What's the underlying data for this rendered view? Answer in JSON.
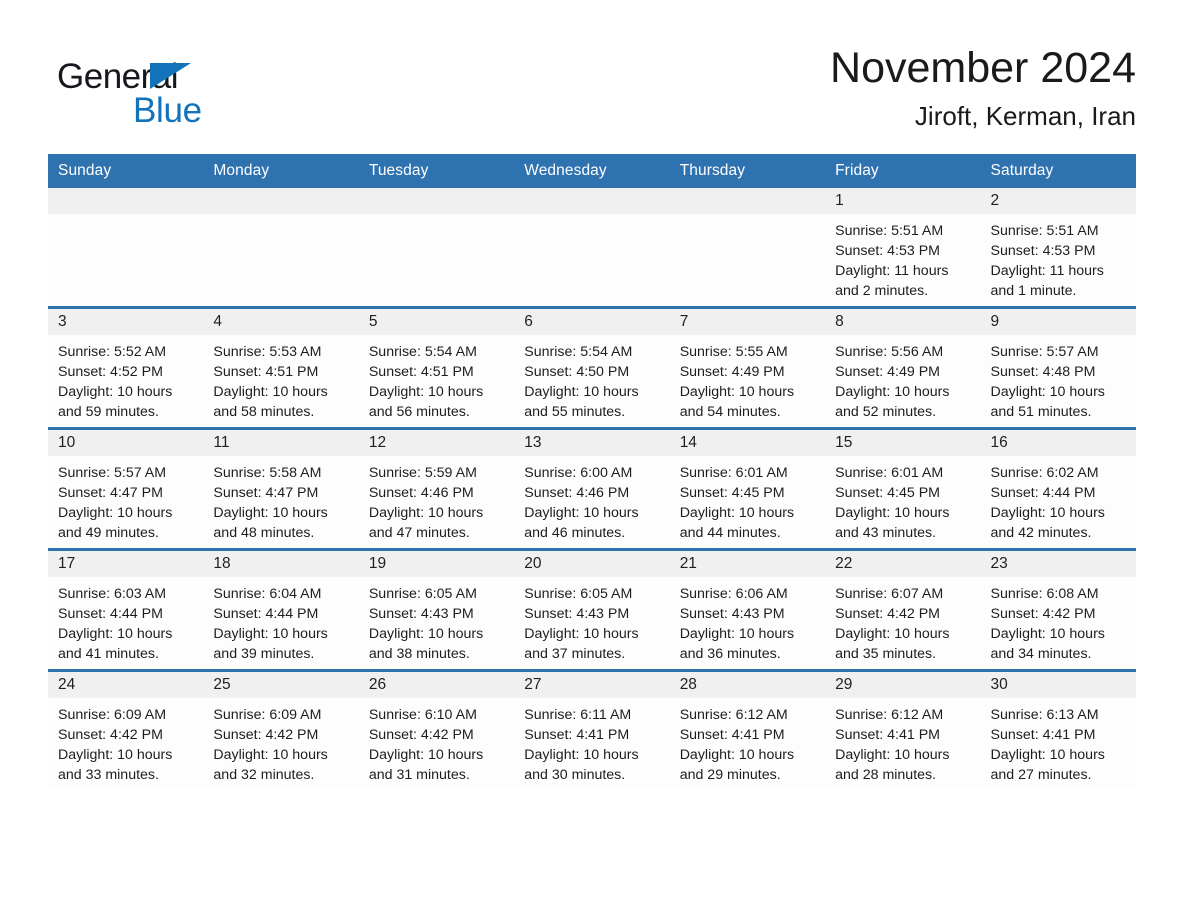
{
  "brand": {
    "name_top": "General",
    "name_bottom": "Blue",
    "accent_color": "#1273bb"
  },
  "header": {
    "title": "November 2024",
    "location": "Jiroft, Kerman, Iran",
    "header_bg_color": "#2e72b0"
  },
  "weekdays": [
    "Sunday",
    "Monday",
    "Tuesday",
    "Wednesday",
    "Thursday",
    "Friday",
    "Saturday"
  ],
  "labels": {
    "sunrise_prefix": "Sunrise:",
    "sunset_prefix": "Sunset:",
    "daylight_prefix": "Daylight:"
  },
  "weeks": [
    [
      {
        "day": "",
        "empty": true
      },
      {
        "day": "",
        "empty": true
      },
      {
        "day": "",
        "empty": true
      },
      {
        "day": "",
        "empty": true
      },
      {
        "day": "",
        "empty": true
      },
      {
        "day": "1",
        "sunrise": "Sunrise: 5:51 AM",
        "sunset": "Sunset: 4:53 PM",
        "daylight": "Daylight: 11 hours and 2 minutes."
      },
      {
        "day": "2",
        "sunrise": "Sunrise: 5:51 AM",
        "sunset": "Sunset: 4:53 PM",
        "daylight": "Daylight: 11 hours and 1 minute."
      }
    ],
    [
      {
        "day": "3",
        "sunrise": "Sunrise: 5:52 AM",
        "sunset": "Sunset: 4:52 PM",
        "daylight": "Daylight: 10 hours and 59 minutes."
      },
      {
        "day": "4",
        "sunrise": "Sunrise: 5:53 AM",
        "sunset": "Sunset: 4:51 PM",
        "daylight": "Daylight: 10 hours and 58 minutes."
      },
      {
        "day": "5",
        "sunrise": "Sunrise: 5:54 AM",
        "sunset": "Sunset: 4:51 PM",
        "daylight": "Daylight: 10 hours and 56 minutes."
      },
      {
        "day": "6",
        "sunrise": "Sunrise: 5:54 AM",
        "sunset": "Sunset: 4:50 PM",
        "daylight": "Daylight: 10 hours and 55 minutes."
      },
      {
        "day": "7",
        "sunrise": "Sunrise: 5:55 AM",
        "sunset": "Sunset: 4:49 PM",
        "daylight": "Daylight: 10 hours and 54 minutes."
      },
      {
        "day": "8",
        "sunrise": "Sunrise: 5:56 AM",
        "sunset": "Sunset: 4:49 PM",
        "daylight": "Daylight: 10 hours and 52 minutes."
      },
      {
        "day": "9",
        "sunrise": "Sunrise: 5:57 AM",
        "sunset": "Sunset: 4:48 PM",
        "daylight": "Daylight: 10 hours and 51 minutes."
      }
    ],
    [
      {
        "day": "10",
        "sunrise": "Sunrise: 5:57 AM",
        "sunset": "Sunset: 4:47 PM",
        "daylight": "Daylight: 10 hours and 49 minutes."
      },
      {
        "day": "11",
        "sunrise": "Sunrise: 5:58 AM",
        "sunset": "Sunset: 4:47 PM",
        "daylight": "Daylight: 10 hours and 48 minutes."
      },
      {
        "day": "12",
        "sunrise": "Sunrise: 5:59 AM",
        "sunset": "Sunset: 4:46 PM",
        "daylight": "Daylight: 10 hours and 47 minutes."
      },
      {
        "day": "13",
        "sunrise": "Sunrise: 6:00 AM",
        "sunset": "Sunset: 4:46 PM",
        "daylight": "Daylight: 10 hours and 46 minutes."
      },
      {
        "day": "14",
        "sunrise": "Sunrise: 6:01 AM",
        "sunset": "Sunset: 4:45 PM",
        "daylight": "Daylight: 10 hours and 44 minutes."
      },
      {
        "day": "15",
        "sunrise": "Sunrise: 6:01 AM",
        "sunset": "Sunset: 4:45 PM",
        "daylight": "Daylight: 10 hours and 43 minutes."
      },
      {
        "day": "16",
        "sunrise": "Sunrise: 6:02 AM",
        "sunset": "Sunset: 4:44 PM",
        "daylight": "Daylight: 10 hours and 42 minutes."
      }
    ],
    [
      {
        "day": "17",
        "sunrise": "Sunrise: 6:03 AM",
        "sunset": "Sunset: 4:44 PM",
        "daylight": "Daylight: 10 hours and 41 minutes."
      },
      {
        "day": "18",
        "sunrise": "Sunrise: 6:04 AM",
        "sunset": "Sunset: 4:44 PM",
        "daylight": "Daylight: 10 hours and 39 minutes."
      },
      {
        "day": "19",
        "sunrise": "Sunrise: 6:05 AM",
        "sunset": "Sunset: 4:43 PM",
        "daylight": "Daylight: 10 hours and 38 minutes."
      },
      {
        "day": "20",
        "sunrise": "Sunrise: 6:05 AM",
        "sunset": "Sunset: 4:43 PM",
        "daylight": "Daylight: 10 hours and 37 minutes."
      },
      {
        "day": "21",
        "sunrise": "Sunrise: 6:06 AM",
        "sunset": "Sunset: 4:43 PM",
        "daylight": "Daylight: 10 hours and 36 minutes."
      },
      {
        "day": "22",
        "sunrise": "Sunrise: 6:07 AM",
        "sunset": "Sunset: 4:42 PM",
        "daylight": "Daylight: 10 hours and 35 minutes."
      },
      {
        "day": "23",
        "sunrise": "Sunrise: 6:08 AM",
        "sunset": "Sunset: 4:42 PM",
        "daylight": "Daylight: 10 hours and 34 minutes."
      }
    ],
    [
      {
        "day": "24",
        "sunrise": "Sunrise: 6:09 AM",
        "sunset": "Sunset: 4:42 PM",
        "daylight": "Daylight: 10 hours and 33 minutes."
      },
      {
        "day": "25",
        "sunrise": "Sunrise: 6:09 AM",
        "sunset": "Sunset: 4:42 PM",
        "daylight": "Daylight: 10 hours and 32 minutes."
      },
      {
        "day": "26",
        "sunrise": "Sunrise: 6:10 AM",
        "sunset": "Sunset: 4:42 PM",
        "daylight": "Daylight: 10 hours and 31 minutes."
      },
      {
        "day": "27",
        "sunrise": "Sunrise: 6:11 AM",
        "sunset": "Sunset: 4:41 PM",
        "daylight": "Daylight: 10 hours and 30 minutes."
      },
      {
        "day": "28",
        "sunrise": "Sunrise: 6:12 AM",
        "sunset": "Sunset: 4:41 PM",
        "daylight": "Daylight: 10 hours and 29 minutes."
      },
      {
        "day": "29",
        "sunrise": "Sunrise: 6:12 AM",
        "sunset": "Sunset: 4:41 PM",
        "daylight": "Daylight: 10 hours and 28 minutes."
      },
      {
        "day": "30",
        "sunrise": "Sunrise: 6:13 AM",
        "sunset": "Sunset: 4:41 PM",
        "daylight": "Daylight: 10 hours and 27 minutes."
      }
    ]
  ]
}
